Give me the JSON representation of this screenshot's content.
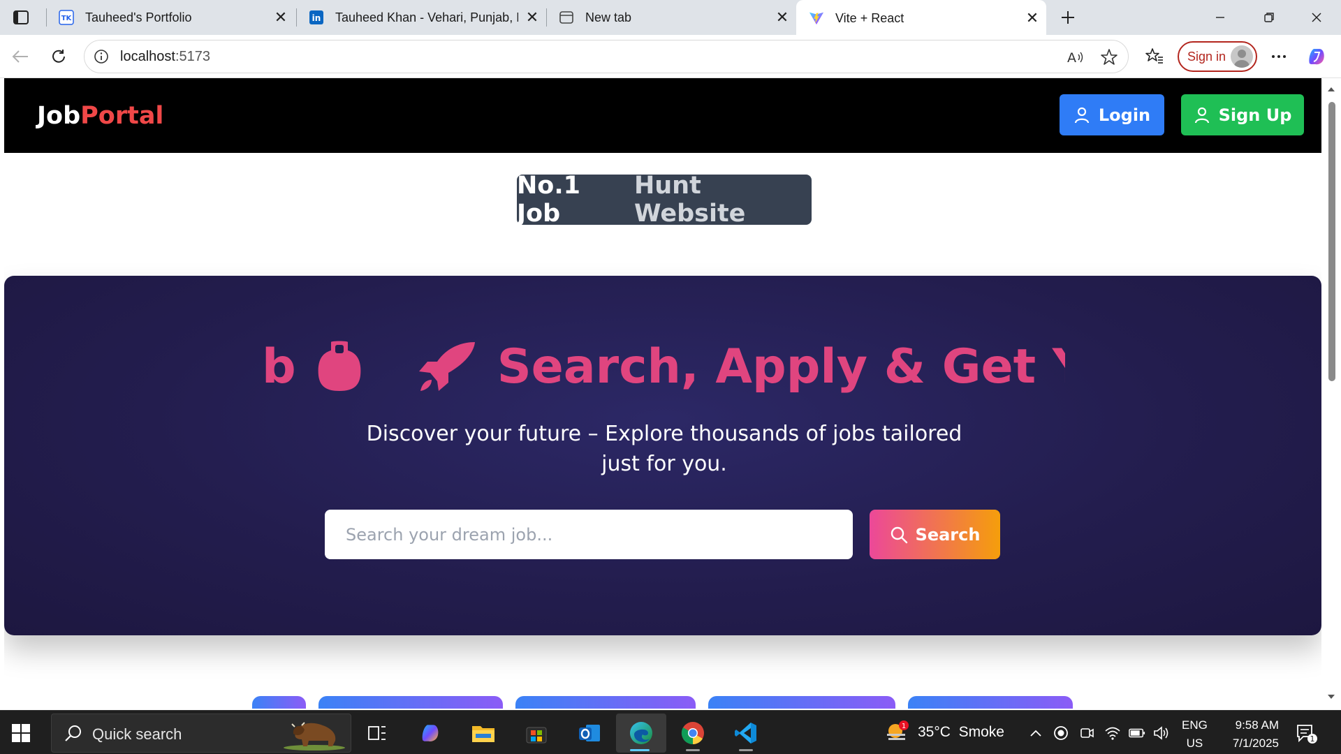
{
  "browser": {
    "tabs": [
      {
        "title": "Tauheed's Portfolio",
        "favicon": "portfolio-icon"
      },
      {
        "title": "Tauheed Khan - Vehari, Punjab, Pa",
        "favicon": "linkedin-icon"
      },
      {
        "title": "New tab",
        "favicon": "newtab-icon"
      },
      {
        "title": "Vite + React",
        "favicon": "vite-icon",
        "active": true
      }
    ],
    "url_host": "localhost",
    "url_port": ":5173",
    "sign_in_label": "Sign in"
  },
  "site": {
    "logo_part1": "Job",
    "logo_part2": "Portal",
    "login_label": "Login",
    "signup_label": "Sign Up",
    "badge_part1": "No.1 Job",
    "badge_part2": "Hunt Website",
    "marquee_fragment": "b",
    "marquee_text": "Search, Apply & Get Y",
    "tagline": "Discover your future – Explore thousands of jobs tailored just for you.",
    "search_placeholder": "Search your dream job...",
    "search_button_label": "Search"
  },
  "taskbar": {
    "search_label": "Quick search",
    "weather": "35°C  Smoke",
    "weather_badge": "1",
    "lang_line1": "ENG",
    "lang_line2": "US",
    "time": "9:58 AM",
    "date": "7/1/2025",
    "notif_count": "1"
  },
  "colors": {
    "nav_bg": "#000000",
    "logo_accent": "#f04848",
    "login_btn": "#2f7cf6",
    "signup_btn": "#1fbf55",
    "hero_bg": "#231d4e",
    "marquee": "#e0457f",
    "search_gradient": [
      "#ec4899",
      "#f59e0b"
    ]
  }
}
